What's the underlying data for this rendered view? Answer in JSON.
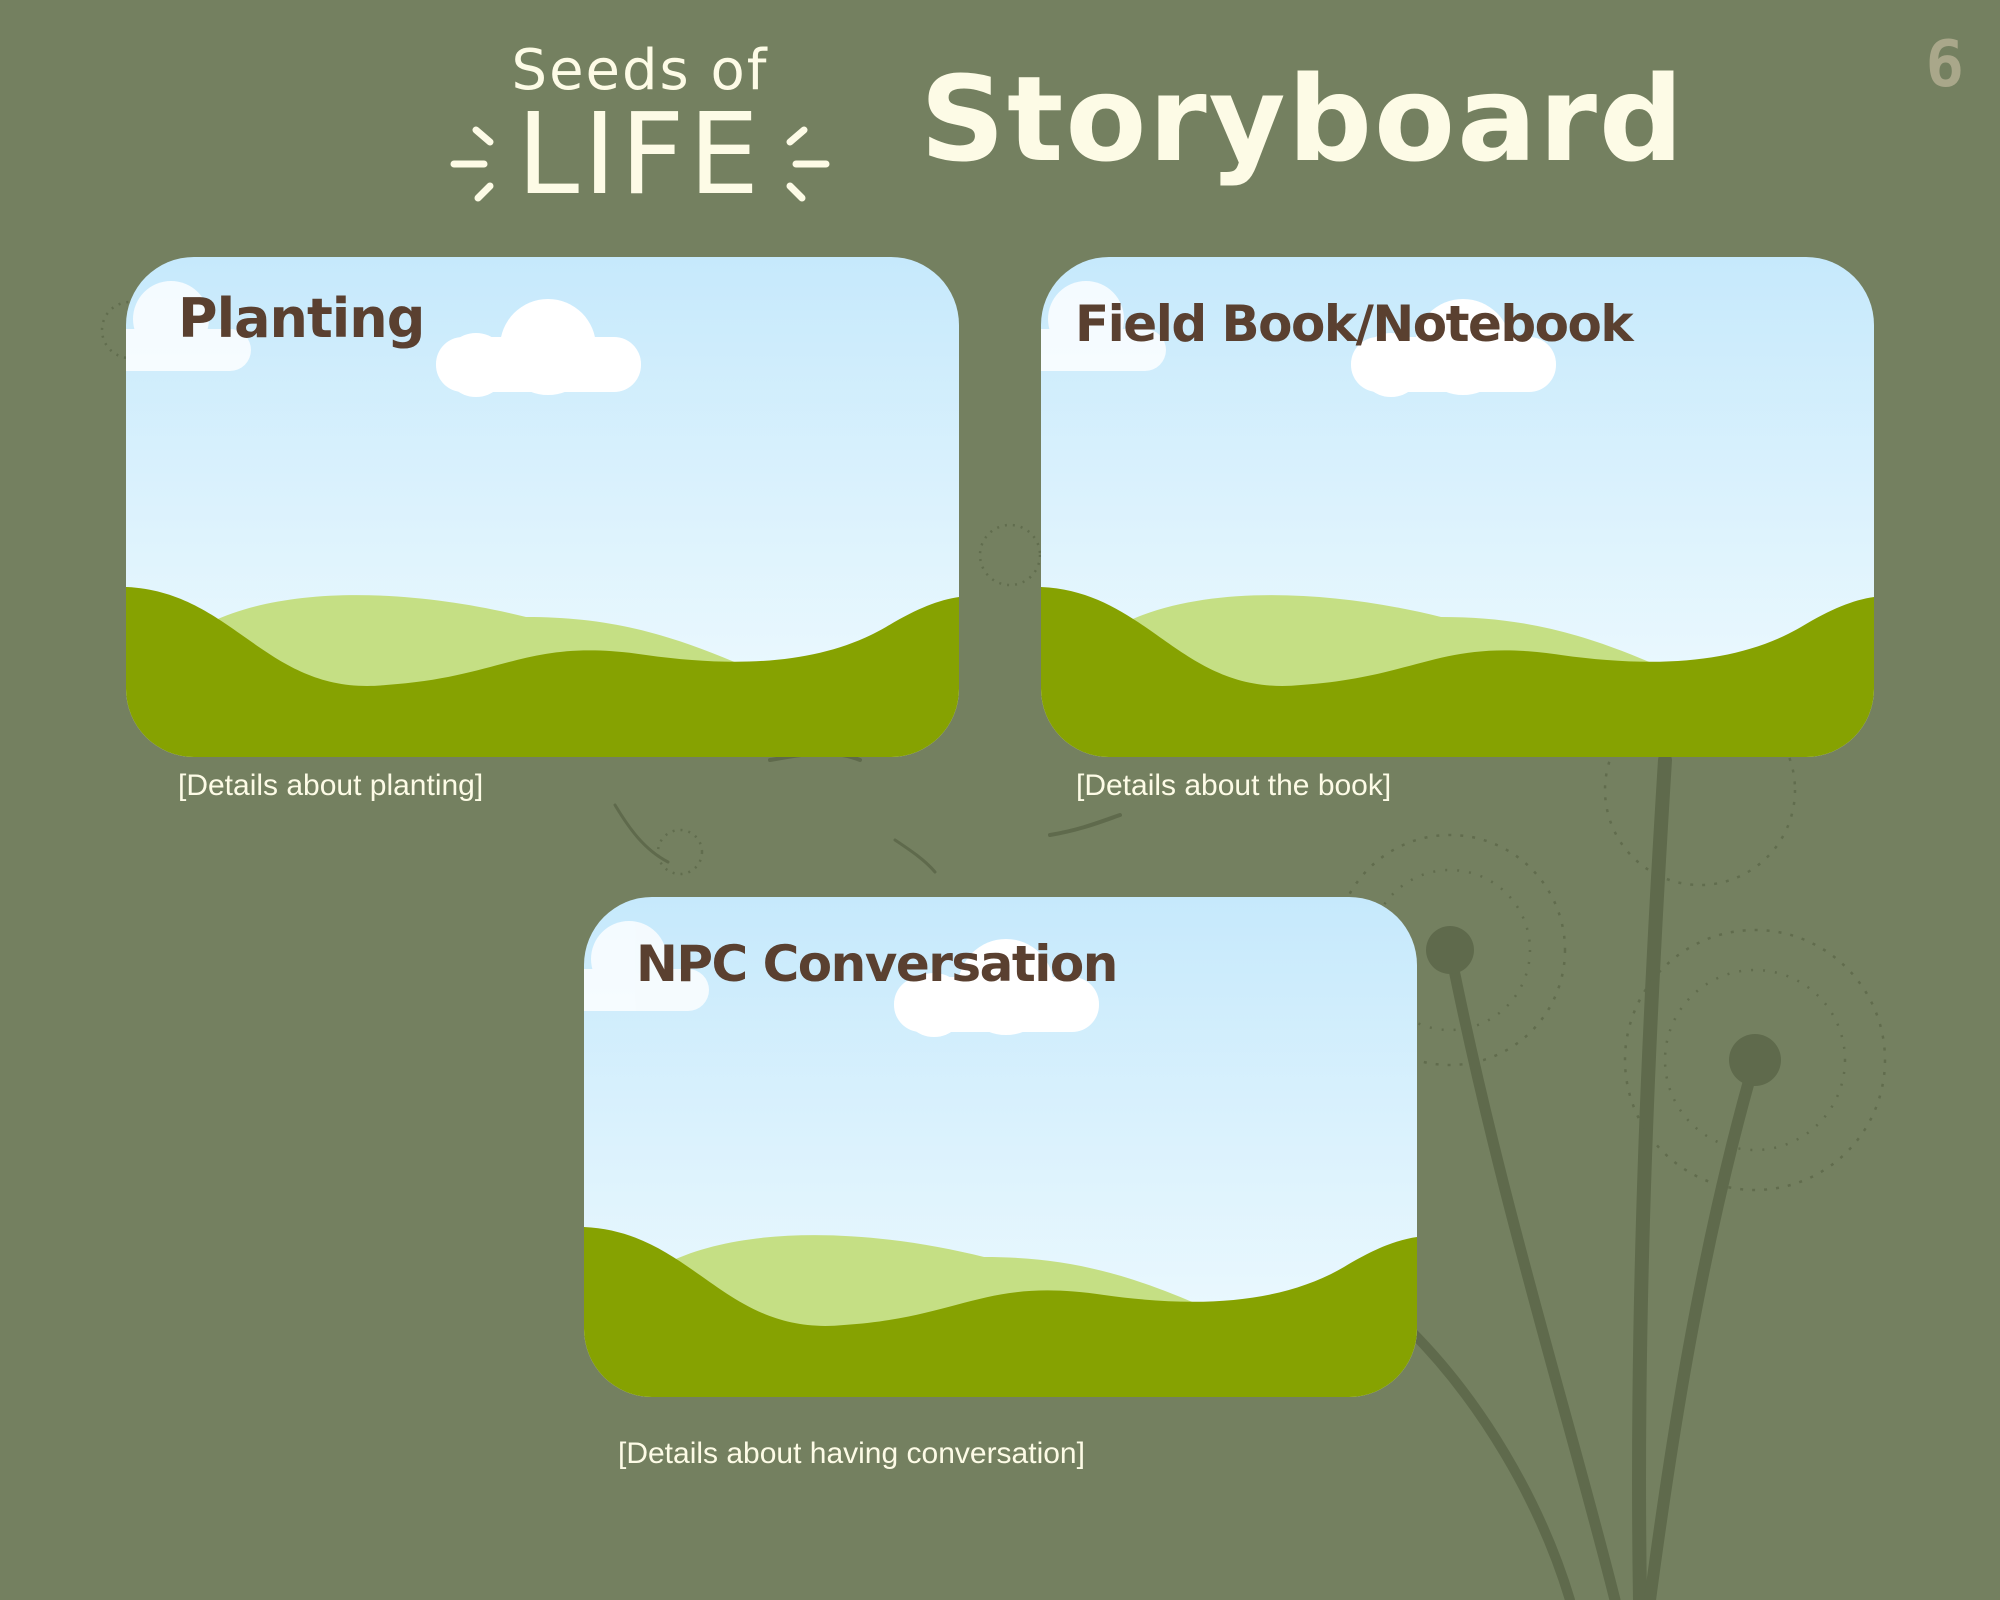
{
  "logo": {
    "line1": "Seeds of",
    "line2": "LIFE"
  },
  "page": {
    "title": "Storyboard",
    "page_number": "6"
  },
  "cards": [
    {
      "title": "Planting",
      "details": "[Details about planting]"
    },
    {
      "title": "Field Book/Notebook",
      "details": "[Details about the book]"
    },
    {
      "title": "NPC Conversation",
      "details": "[Details about having conversation]"
    }
  ],
  "colors": {
    "background": "#748060",
    "sky_top": "#c6e9fc",
    "sky_bottom": "#f1fbfe",
    "hill_light": "#c5df84",
    "hill_dark": "#86a201",
    "title_text": "#5a4030",
    "cream_text": "#fdfbe6"
  }
}
